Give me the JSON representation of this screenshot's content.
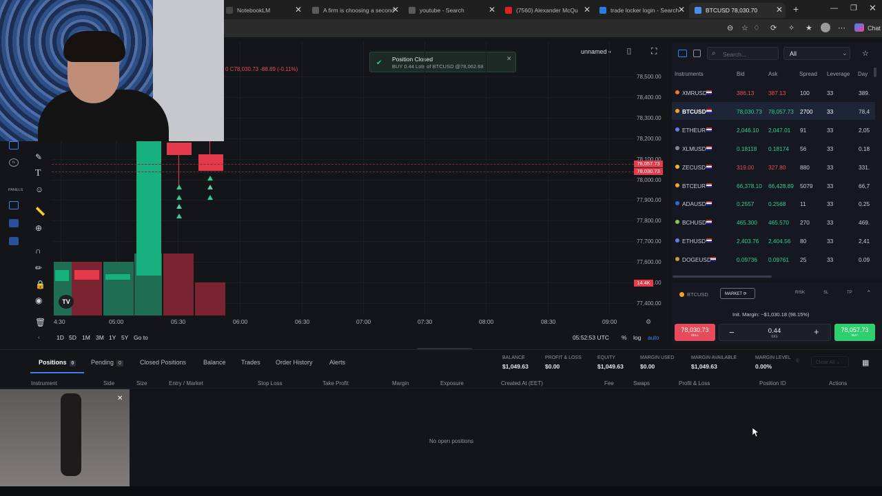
{
  "browser": {
    "tabs": [
      {
        "label": "NotebookLM",
        "color": "#444"
      },
      {
        "label": "A firm is choosing a second",
        "color": "#5a5a5a"
      },
      {
        "label": "youtube - Search",
        "color": "#5a5a5a"
      },
      {
        "label": "(7560) Alexander McQu",
        "color": "#e02020"
      },
      {
        "label": "trade locker login - Search",
        "color": "#2a7be4"
      },
      {
        "label": "BTCUSD 78,030.70",
        "color": "#4a8ef0"
      }
    ],
    "new_tab": "+",
    "chat_label": "Chat"
  },
  "chart": {
    "layout_name": "unnamed",
    "ohlc_text": "0 C78,030.73 -88.89 (-0.11%)",
    "notification": {
      "title": "Position Closed",
      "body": "BUY  0.44 Lots of BTCUSD @78,062.68"
    },
    "y_ticks": [
      "78,500.00",
      "78,400.00",
      "78,300.00",
      "78,200.00",
      "78,100.00",
      "78,000.00",
      "77,900.00",
      "77,800.00",
      "77,700.00",
      "77,600.00",
      "77,500.00",
      "77,400.00"
    ],
    "price_tag_ask": "78,057.73",
    "price_tag_bid": "78,030.73",
    "volume_tag": "14.4K",
    "x_ticks": [
      "4:30",
      "05:00",
      "05:30",
      "06:00",
      "06:30",
      "07:00",
      "07:30",
      "08:00",
      "08:30",
      "09:00"
    ],
    "ranges": [
      "1D",
      "5D",
      "1M",
      "3M",
      "1Y",
      "5Y",
      "Go to"
    ],
    "clock": "05:52:53 UTC",
    "pct": "%",
    "log": "log",
    "auto": "auto",
    "panels_label": "PANELS"
  },
  "instruments": {
    "search_placeholder": "Search...",
    "filter": "All",
    "headers": [
      "Instruments",
      "Bid",
      "Ask",
      "Spread",
      "Leverage",
      "Day"
    ],
    "rows": [
      {
        "sym": "XMRUSD",
        "bid": "386.13",
        "ask": "387.13",
        "spread": "100",
        "lev": "33",
        "day": "389.",
        "bid_color": "#e84b5a",
        "ask_color": "#e84b5a",
        "dot": "#f07a2a"
      },
      {
        "sym": "BTCUSD",
        "bid": "78,030.73",
        "ask": "78,057.73",
        "spread": "2700",
        "lev": "33",
        "day": "78,4",
        "bid_color": "#2fcf8f",
        "ask_color": "#2fcf8f",
        "dot": "#f3a329"
      },
      {
        "sym": "ETHEUR",
        "bid": "2,046.10",
        "ask": "2,047.01",
        "spread": "91",
        "lev": "33",
        "day": "2,05",
        "bid_color": "#2fcf8f",
        "ask_color": "#2fcf8f",
        "dot": "#627eea"
      },
      {
        "sym": "XLMUSD",
        "bid": "0.18118",
        "ask": "0.18174",
        "spread": "56",
        "lev": "33",
        "day": "0.18",
        "bid_color": "#2fcf8f",
        "ask_color": "#2fcf8f",
        "dot": "#888"
      },
      {
        "sym": "ZECUSD",
        "bid": "319.00",
        "ask": "327.80",
        "spread": "880",
        "lev": "33",
        "day": "331.",
        "bid_color": "#e84b5a",
        "ask_color": "#e84b5a",
        "dot": "#f4b728"
      },
      {
        "sym": "BTCEUR",
        "bid": "66,378.10",
        "ask": "66,428.89",
        "spread": "5079",
        "lev": "33",
        "day": "66,7",
        "bid_color": "#2fcf8f",
        "ask_color": "#2fcf8f",
        "dot": "#f3a329"
      },
      {
        "sym": "ADAUSD",
        "bid": "0.2557",
        "ask": "0.2568",
        "spread": "11",
        "lev": "33",
        "day": "0.25",
        "bid_color": "#2fcf8f",
        "ask_color": "#2fcf8f",
        "dot": "#3468d1"
      },
      {
        "sym": "BCHUSD",
        "bid": "465.300",
        "ask": "465.570",
        "spread": "270",
        "lev": "33",
        "day": "469.",
        "bid_color": "#2fcf8f",
        "ask_color": "#2fcf8f",
        "dot": "#8dc351"
      },
      {
        "sym": "ETHUSD",
        "bid": "2,403.76",
        "ask": "2,404.56",
        "spread": "80",
        "lev": "33",
        "day": "2,41",
        "bid_color": "#2fcf8f",
        "ask_color": "#2fcf8f",
        "dot": "#627eea"
      },
      {
        "sym": "DOGEUSD",
        "bid": "0.09736",
        "ask": "0.09761",
        "spread": "25",
        "lev": "33",
        "day": "0.09",
        "bid_color": "#2fcf8f",
        "ask_color": "#2fcf8f",
        "dot": "#c2a633"
      }
    ]
  },
  "order": {
    "symbol": "BTCUSD",
    "type": "MARKET",
    "risk": "RISK",
    "sl": "SL",
    "tp": "TP",
    "margin": "Init. Margin: ~$1,030.18 (98.15%)",
    "sell_price": "78,030.73",
    "sell_label": "SELL",
    "qty": "0.44",
    "qty_unit": "lots",
    "buy_price": "78,057.73",
    "buy_label": "BUY"
  },
  "bottom": {
    "tabs": [
      {
        "label": "Positions",
        "count": "0"
      },
      {
        "label": "Pending",
        "count": "0"
      },
      {
        "label": "Closed Positions"
      },
      {
        "label": "Balance"
      },
      {
        "label": "Trades"
      },
      {
        "label": "Order History"
      },
      {
        "label": "Alerts"
      }
    ],
    "stats": [
      {
        "label": "BALANCE",
        "value": "$1,049.63"
      },
      {
        "label": "PROFIT & LOSS",
        "value": "$0.00"
      },
      {
        "label": "EQUITY",
        "value": "$1,049.63"
      },
      {
        "label": "MARGIN USED",
        "value": "$0.00"
      },
      {
        "label": "MARGIN AVAILABLE",
        "value": "$1,049.63"
      },
      {
        "label": "MARGIN LEVEL",
        "value": "0.00%"
      }
    ],
    "close_all": "Close All",
    "columns": [
      "Instrument",
      "Side",
      "Size",
      "Entry / Market",
      "Stop Loss",
      "Take Profit",
      "Margin",
      "Exposure",
      "Created At (EET)",
      "Fee",
      "Swaps",
      "Profit & Loss",
      "Position ID",
      "Actions"
    ],
    "empty": "No open positions"
  }
}
